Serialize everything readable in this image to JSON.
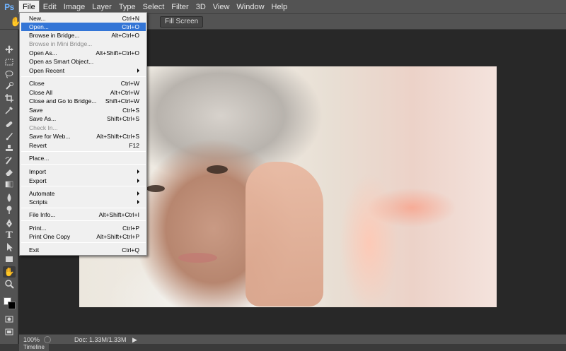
{
  "app": {
    "logo": "Ps"
  },
  "menubar": {
    "items": [
      {
        "label": "File",
        "active": true
      },
      {
        "label": "Edit"
      },
      {
        "label": "Image"
      },
      {
        "label": "Layer"
      },
      {
        "label": "Type"
      },
      {
        "label": "Select"
      },
      {
        "label": "Filter"
      },
      {
        "label": "3D"
      },
      {
        "label": "View"
      },
      {
        "label": "Window"
      },
      {
        "label": "Help"
      }
    ]
  },
  "optionsbar": {
    "tool_icon": "hand-icon",
    "fill_screen_label": "Fill Screen"
  },
  "file_menu": {
    "items": [
      {
        "label": "New...",
        "shortcut": "Ctrl+N"
      },
      {
        "label": "Open...",
        "shortcut": "Ctrl+O",
        "highlighted": true
      },
      {
        "label": "Browse in Bridge...",
        "shortcut": "Alt+Ctrl+O"
      },
      {
        "label": "Browse in Mini Bridge...",
        "shortcut": "",
        "disabled": true
      },
      {
        "label": "Open As...",
        "shortcut": "Alt+Shift+Ctrl+O"
      },
      {
        "label": "Open as Smart Object...",
        "shortcut": ""
      },
      {
        "label": "Open Recent",
        "shortcut": "",
        "submenu": true
      },
      {
        "label": "Close",
        "shortcut": "Ctrl+W"
      },
      {
        "label": "Close All",
        "shortcut": "Alt+Ctrl+W"
      },
      {
        "label": "Close and Go to Bridge...",
        "shortcut": "Shift+Ctrl+W"
      },
      {
        "label": "Save",
        "shortcut": "Ctrl+S"
      },
      {
        "label": "Save As...",
        "shortcut": "Shift+Ctrl+S"
      },
      {
        "label": "Check In...",
        "shortcut": "",
        "disabled": true
      },
      {
        "label": "Save for Web...",
        "shortcut": "Alt+Shift+Ctrl+S"
      },
      {
        "label": "Revert",
        "shortcut": "F12"
      },
      {
        "label": "Place...",
        "shortcut": ""
      },
      {
        "label": "Import",
        "shortcut": "",
        "submenu": true
      },
      {
        "label": "Export",
        "shortcut": "",
        "submenu": true
      },
      {
        "label": "Automate",
        "shortcut": "",
        "submenu": true
      },
      {
        "label": "Scripts",
        "shortcut": "",
        "submenu": true
      },
      {
        "label": "File Info...",
        "shortcut": "Alt+Shift+Ctrl+I"
      },
      {
        "label": "Print...",
        "shortcut": "Ctrl+P"
      },
      {
        "label": "Print One Copy",
        "shortcut": "Alt+Shift+Ctrl+P"
      },
      {
        "label": "Exit",
        "shortcut": "Ctrl+Q"
      }
    ]
  },
  "tools": [
    {
      "icon": "move-icon"
    },
    {
      "icon": "marquee-icon"
    },
    {
      "icon": "lasso-icon"
    },
    {
      "icon": "quick-select-icon"
    },
    {
      "icon": "crop-icon"
    },
    {
      "icon": "eyedropper-icon"
    },
    {
      "icon": "healing-brush-icon"
    },
    {
      "icon": "brush-icon"
    },
    {
      "icon": "clone-stamp-icon"
    },
    {
      "icon": "history-brush-icon"
    },
    {
      "icon": "eraser-icon"
    },
    {
      "icon": "gradient-icon"
    },
    {
      "icon": "blur-icon"
    },
    {
      "icon": "dodge-icon"
    },
    {
      "icon": "pen-icon"
    },
    {
      "icon": "type-icon"
    },
    {
      "icon": "path-select-icon"
    },
    {
      "icon": "rectangle-icon"
    },
    {
      "icon": "hand-icon",
      "selected": true
    },
    {
      "icon": "zoom-icon"
    }
  ],
  "colors": {
    "foreground": "#ffffff",
    "background": "#000000",
    "highlight": "#3375d6"
  },
  "statusbar": {
    "zoom": "100%",
    "doc_size": "Doc: 1.33M/1.33M"
  },
  "timeline": {
    "label": "Timeline"
  }
}
